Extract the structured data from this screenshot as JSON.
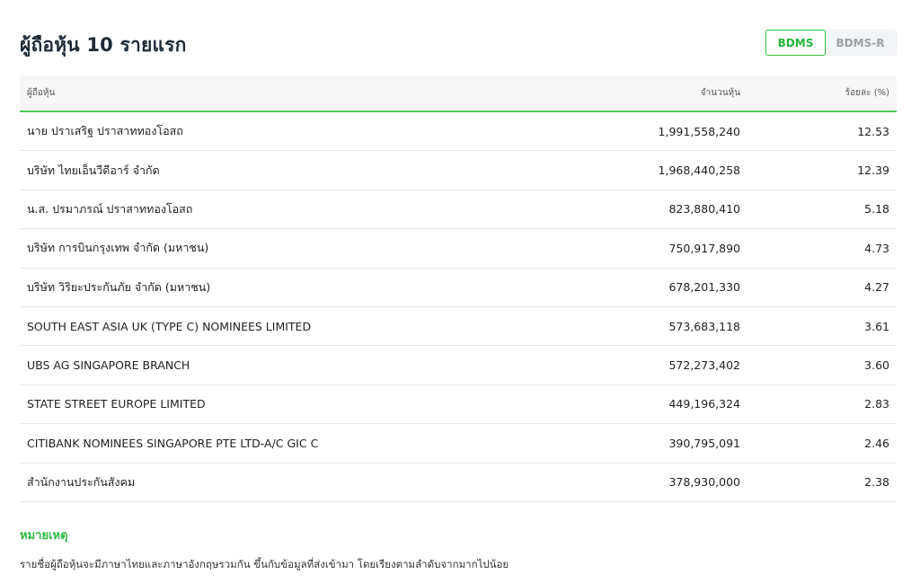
{
  "title": "ผู้ถือหุ้น 10 รายแรก",
  "toggle": {
    "active": "BDMS",
    "inactive": "BDMS-R"
  },
  "table": {
    "headers": {
      "name": "ผู้ถือหุ้น",
      "shares": "จำนวนหุ้น",
      "pct": "ร้อยละ (%)"
    },
    "rows": [
      {
        "name": "นาย ปราเสริฐ ปราสาททองโอสถ",
        "shares": "1,991,558,240",
        "pct": "12.53"
      },
      {
        "name": "บริษัท ไทยเอ็นวีดีอาร์ จำกัด",
        "shares": "1,968,440,258",
        "pct": "12.39"
      },
      {
        "name": "น.ส. ปรมาภรณ์ ปราสาททองโอสถ",
        "shares": "823,880,410",
        "pct": "5.18"
      },
      {
        "name": "บริษัท การบินกรุงเทพ จำกัด (มหาชน)",
        "shares": "750,917,890",
        "pct": "4.73"
      },
      {
        "name": "บริษัท วิริยะประกันภัย จำกัด (มหาชน)",
        "shares": "678,201,330",
        "pct": "4.27"
      },
      {
        "name": "SOUTH EAST ASIA UK (TYPE C) NOMINEES LIMITED",
        "shares": "573,683,118",
        "pct": "3.61"
      },
      {
        "name": "UBS AG SINGAPORE BRANCH",
        "shares": "572,273,402",
        "pct": "3.60"
      },
      {
        "name": "STATE STREET EUROPE LIMITED",
        "shares": "449,196,324",
        "pct": "2.83"
      },
      {
        "name": "CITIBANK NOMINEES SINGAPORE PTE LTD-A/C GIC C",
        "shares": "390,795,091",
        "pct": "2.46"
      },
      {
        "name": "สำนักงานประกันสังคม",
        "shares": "378,930,000",
        "pct": "2.38"
      }
    ]
  },
  "note": {
    "title": "หมายเหตุ",
    "text": "รายชื่อผู้ถือหุ้นจะมีภาษาไทยและภาษาอังกฤษรวมกัน ขึ้นกับข้อมูลที่ส่งเข้ามา โดยเรียงตามลำดับจากมากไปน้อย"
  },
  "colors": {
    "accent": "#2fc23f",
    "title": "#1f2a37",
    "header_bg": "#f7f7f7"
  }
}
